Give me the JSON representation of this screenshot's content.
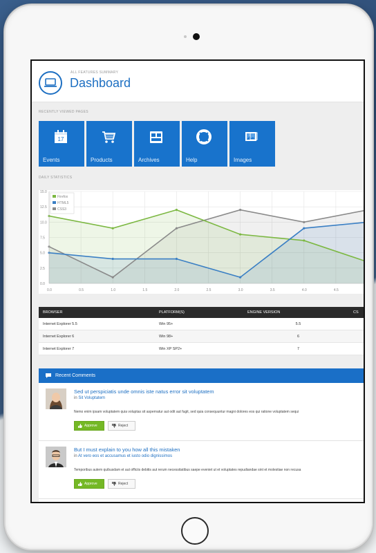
{
  "header": {
    "subtitle": "ALL FEATURES SUMMARY",
    "title": "Dashboard"
  },
  "sections": {
    "recent": "RECENTLY VIEWED PAGES",
    "daily": "DAILY STATISTICS"
  },
  "tiles": [
    {
      "label": "Events",
      "icon": "calendar-icon",
      "badge": "17"
    },
    {
      "label": "Products",
      "icon": "cart-icon"
    },
    {
      "label": "Archives",
      "icon": "archive-icon"
    },
    {
      "label": "Help",
      "icon": "lifebuoy-icon"
    },
    {
      "label": "Images",
      "icon": "image-icon"
    }
  ],
  "chart_data": {
    "type": "area",
    "legend": [
      "Firefox",
      "HTML5",
      "CSS3"
    ],
    "x": [
      0.0,
      0.5,
      1.0,
      1.5,
      2.0,
      2.5,
      3.0,
      3.5,
      4.0,
      4.5
    ],
    "x_tick_labels": [
      "0.0",
      "0.5",
      "1.0",
      "1.5",
      "2.0",
      "2.5",
      "3.0",
      "3.5",
      "4.0",
      "4.5"
    ],
    "y_tick_labels": [
      "15.0",
      "12.5",
      "10.0",
      "7.5",
      "5.0",
      "2.5",
      "0.0"
    ],
    "ylim": [
      0,
      15
    ],
    "series": [
      {
        "name": "Firefox",
        "color": "#7cb842",
        "points": [
          [
            0,
            11
          ],
          [
            1,
            9
          ],
          [
            2,
            12
          ],
          [
            3,
            8
          ],
          [
            4,
            7
          ],
          [
            5,
            3.5
          ]
        ]
      },
      {
        "name": "HTML5",
        "color": "#3a7fc4",
        "points": [
          [
            0,
            5
          ],
          [
            1,
            4
          ],
          [
            2,
            4
          ],
          [
            3,
            1
          ],
          [
            4,
            9
          ],
          [
            5,
            10
          ]
        ]
      },
      {
        "name": "CSS3",
        "color": "#8a8a8a",
        "points": [
          [
            0,
            6
          ],
          [
            1,
            1
          ],
          [
            2,
            9
          ],
          [
            3,
            12
          ],
          [
            4,
            10
          ],
          [
            5,
            12
          ]
        ]
      }
    ]
  },
  "table": {
    "headers": [
      "BROWSER",
      "PLATFORM(S)",
      "ENGINE VERSION",
      "CS"
    ],
    "rows": [
      [
        "Internet Explorer 5.5",
        "Win 95+",
        "5.5"
      ],
      [
        "Internet Explorer 6",
        "Win 98+",
        "6"
      ],
      [
        "Internet Explorer 7",
        "Win XP SP2+",
        "7"
      ]
    ]
  },
  "comments": {
    "heading": "Recent Comments",
    "items": [
      {
        "title": "Sed ut perspiciatis unde omnis iste natus error sit voluptatem",
        "in_prefix": "in",
        "in_link": "Sit Voluptatem",
        "text": "Nemo enim ipsam voluptatem quia voluptas sit aspernatur aut odit aut fugit, sed quia consequuntur magni dolores eos qui ratione voluptatem sequi",
        "approve": "Approve",
        "reject": "Reject"
      },
      {
        "title": "But I must explain to you how all this mistaken",
        "in_prefix": "in",
        "in_link": "At vero eos et accusamus et iusto odio dignissimos",
        "text": "Temporibus autem quibusdam et aut officiis debitis aut rerum necessitatibus saepe eveniet ut et voluptates repudiandae sint et molestiae non recusa",
        "approve": "Approve",
        "reject": "Reject"
      }
    ]
  }
}
